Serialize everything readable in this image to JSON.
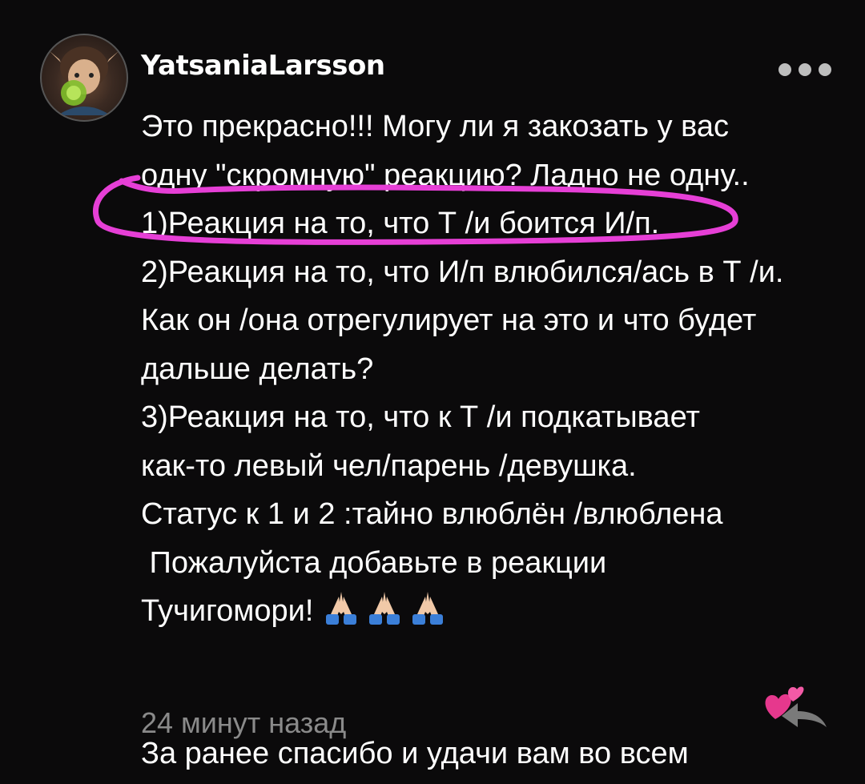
{
  "comment": {
    "author": "YatsaniaLarsson",
    "lines": [
      "Это прекрасно!!! Могу ли я закозать у вас",
      "одну \"скромную\" реакцию? Ладно не одну..",
      "1)Реакция на то, что Т /и боится И/п.",
      "2)Реакция на то, что И/п влюбился/ась в Т /и.",
      "Как он /она отрегулирует на это и что будет",
      "дальше делать?",
      "3)Реакция на то, что к Т /и подкатывает",
      "как-то левый чел/парень /девушка.",
      "Статус к 1 и 2 :тайно влюблён /влюблена",
      " Пожалуйста добавьте в реакции",
      "Тучигомори!",
      "За ранее спасибо и удачи вам во всем"
    ],
    "emojis": {
      "hands_icon": "folded-hands-emoji",
      "hearts_icon": "two-hearts-emoji"
    },
    "timestamp": "24 минут назад"
  },
  "colors": {
    "background": "#0b0a0b",
    "text": "#ffffff",
    "muted": "#8a8a8a",
    "highlight": "#e63fd6"
  }
}
